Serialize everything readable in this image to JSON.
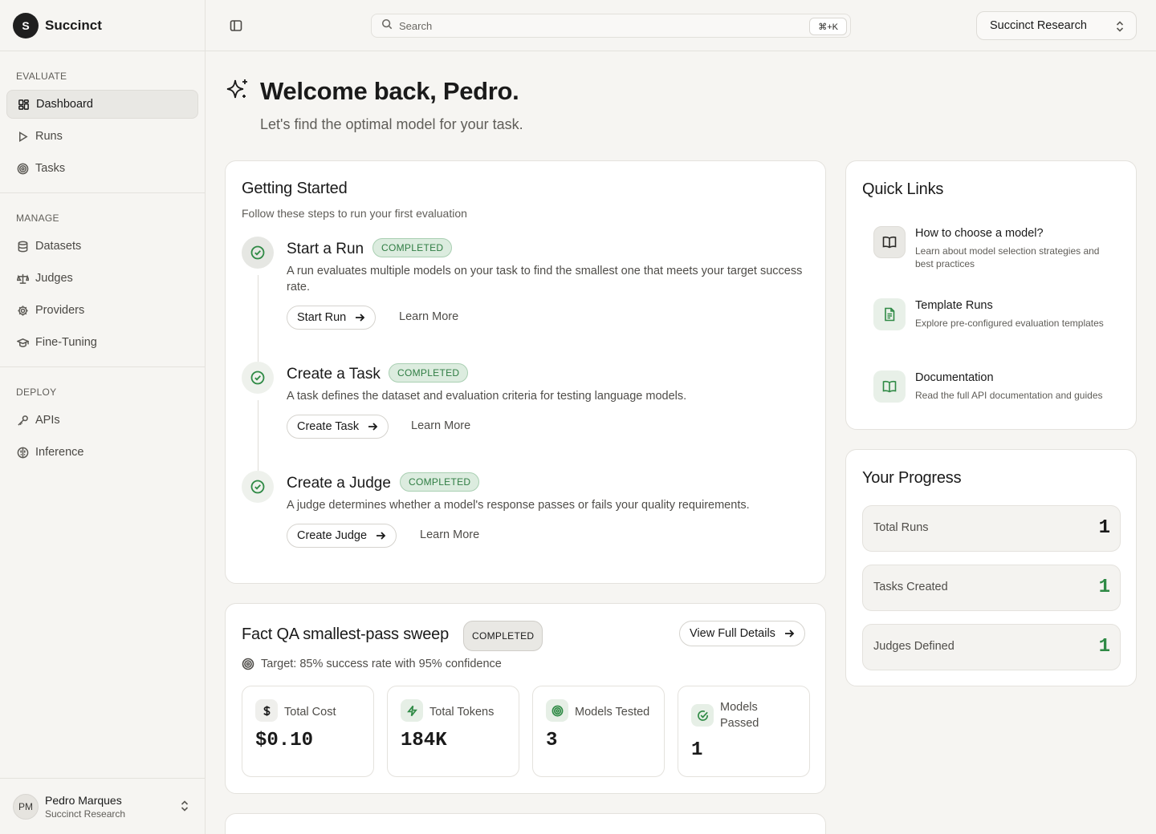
{
  "brand": {
    "initial": "S",
    "name": "Succinct"
  },
  "sidebar": {
    "sections": [
      {
        "heading": "EVALUATE",
        "items": [
          {
            "label": "Dashboard",
            "icon": "dashboard-icon",
            "active": true
          },
          {
            "label": "Runs",
            "icon": "play-icon"
          },
          {
            "label": "Tasks",
            "icon": "target-icon"
          }
        ]
      },
      {
        "heading": "MANAGE",
        "items": [
          {
            "label": "Datasets",
            "icon": "database-icon"
          },
          {
            "label": "Judges",
            "icon": "scale-icon"
          },
          {
            "label": "Providers",
            "icon": "gear-icon"
          },
          {
            "label": "Fine-Tuning",
            "icon": "graduation-cap-icon"
          }
        ]
      },
      {
        "heading": "DEPLOY",
        "items": [
          {
            "label": "APIs",
            "icon": "key-icon"
          },
          {
            "label": "Inference",
            "icon": "brain-icon"
          }
        ]
      }
    ]
  },
  "user": {
    "initials": "PM",
    "name": "Pedro Marques",
    "org": "Succinct Research"
  },
  "topbar": {
    "search_placeholder": "Search",
    "shortcut": "⌘+K",
    "org_selector": "Succinct Research"
  },
  "welcome": {
    "title": "Welcome back, Pedro.",
    "subtitle": "Let's find the optimal model for your task."
  },
  "getting_started": {
    "title": "Getting Started",
    "subtitle": "Follow these steps to run your first evaluation",
    "steps": [
      {
        "title": "Start a Run",
        "status": "COMPLETED",
        "description": "A run evaluates multiple models on your task to find the smallest one that meets your target success rate.",
        "action": "Start Run",
        "learn_more": "Learn More"
      },
      {
        "title": "Create a Task",
        "status": "COMPLETED",
        "description": "A task defines the dataset and evaluation criteria for testing language models.",
        "action": "Create Task",
        "learn_more": "Learn More"
      },
      {
        "title": "Create a Judge",
        "status": "COMPLETED",
        "description": "A judge determines whether a model's response passes or fails your quality requirements.",
        "action": "Create Judge",
        "learn_more": "Learn More"
      }
    ]
  },
  "sweep": {
    "title": "Fact QA smallest-pass sweep",
    "status": "COMPLETED",
    "view_details": "View Full Details",
    "target": "Target: 85% success rate with 95% confidence",
    "metrics": [
      {
        "label": "Total Cost",
        "value": "$0.10",
        "icon": "dollar-icon"
      },
      {
        "label": "Total Tokens",
        "value": "184K",
        "icon": "lightning-icon"
      },
      {
        "label": "Models Tested",
        "value": "3",
        "icon": "target-icon"
      },
      {
        "label": "Models Passed",
        "value": "1",
        "icon": "check-circle-icon"
      }
    ]
  },
  "quick_links": {
    "title": "Quick Links",
    "items": [
      {
        "title": "How to choose a model?",
        "description": "Learn about model selection strategies and best practices",
        "icon": "book-icon"
      },
      {
        "title": "Template Runs",
        "description": "Explore pre-configured evaluation templates",
        "icon": "document-icon"
      },
      {
        "title": "Documentation",
        "description": "Read the full API documentation and guides",
        "icon": "book-open-icon"
      }
    ]
  },
  "progress": {
    "title": "Your Progress",
    "rows": [
      {
        "label": "Total Runs",
        "value": "1"
      },
      {
        "label": "Tasks Created",
        "value": "1"
      },
      {
        "label": "Judges Defined",
        "value": "1"
      }
    ]
  },
  "colors": {
    "accent_green": "#2f8a45",
    "badge_green_bg": "#dcecdf",
    "page_bg": "#f6f5f2",
    "card_bg": "#ffffff"
  }
}
